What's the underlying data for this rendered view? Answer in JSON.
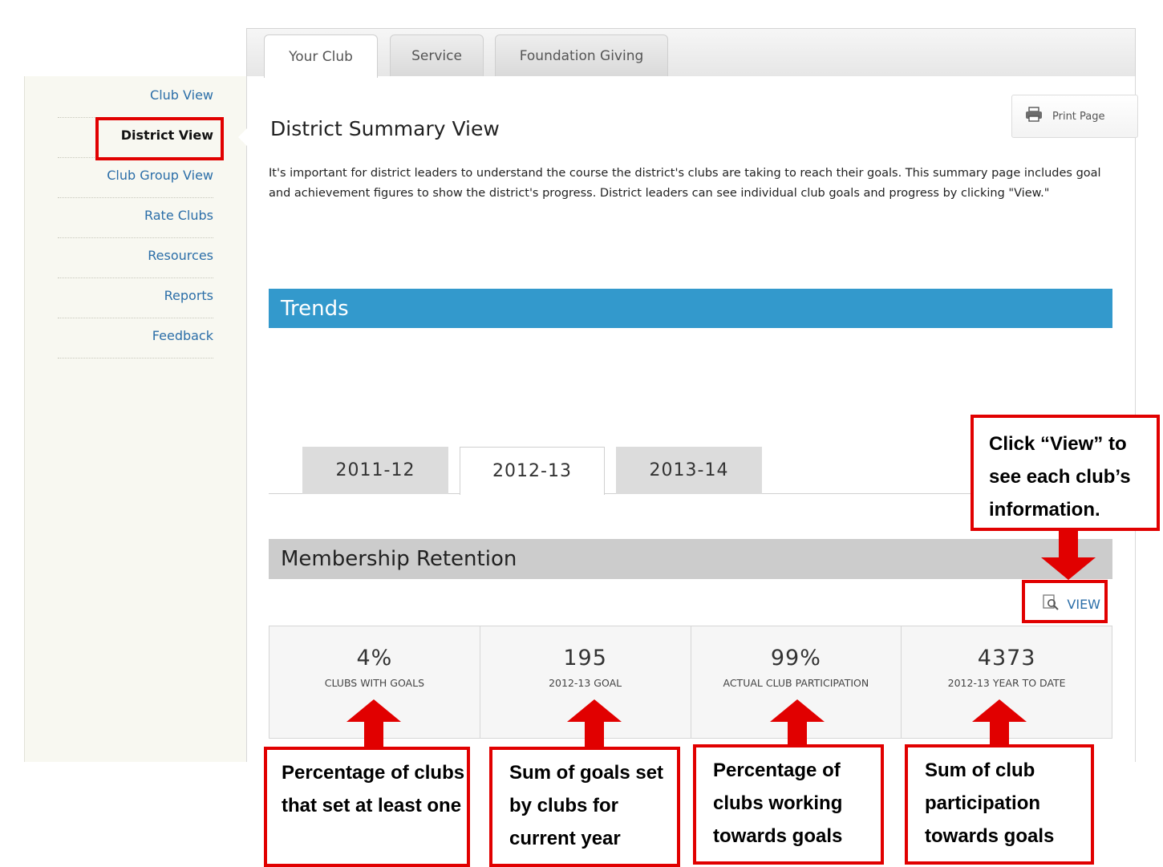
{
  "tabs": [
    {
      "label": "Your Club",
      "active": true
    },
    {
      "label": "Service",
      "active": false
    },
    {
      "label": "Foundation Giving",
      "active": false
    }
  ],
  "sidebar": {
    "items": [
      {
        "label": "Club View"
      },
      {
        "label": "District View",
        "current": true
      },
      {
        "label": "Club Group View"
      },
      {
        "label": "Rate Clubs"
      },
      {
        "label": "Resources"
      },
      {
        "label": "Reports"
      },
      {
        "label": "Feedback"
      }
    ]
  },
  "main": {
    "title": "District Summary View",
    "print_label": "Print Page",
    "intro": "It's important for district leaders to understand the course the district's clubs are taking to reach their goals. This summary page includes goal and achievement figures to show the district's progress. District leaders can see individual club goals and progress by clicking \"View.\"",
    "trends_heading": "Trends",
    "year_tabs": [
      {
        "label": "2011-12",
        "active": false
      },
      {
        "label": "2012-13",
        "active": true
      },
      {
        "label": "2013-14",
        "active": false
      }
    ],
    "retention_heading": "Membership Retention",
    "view_label": "VIEW",
    "stats": [
      {
        "value": "4%",
        "label": "CLUBS WITH GOALS"
      },
      {
        "value": "195",
        "label": "2012-13 GOAL"
      },
      {
        "value": "99%",
        "label": "ACTUAL CLUB PARTICIPATION"
      },
      {
        "value": "4373",
        "label": "2012-13 YEAR TO DATE"
      }
    ]
  },
  "annotations": {
    "view_callout": "Click “View” to see each club’s information.",
    "callouts": [
      "Percentage of clubs that set at least one",
      "Sum of goals set by clubs for current year",
      "Percentage of clubs working towards goals",
      "Sum of club participation towards goals"
    ]
  },
  "colors": {
    "accent_blue": "#3399cc",
    "link_blue": "#2b6ea8",
    "annotation_red": "#e10000",
    "section_grey": "#cccccc"
  }
}
